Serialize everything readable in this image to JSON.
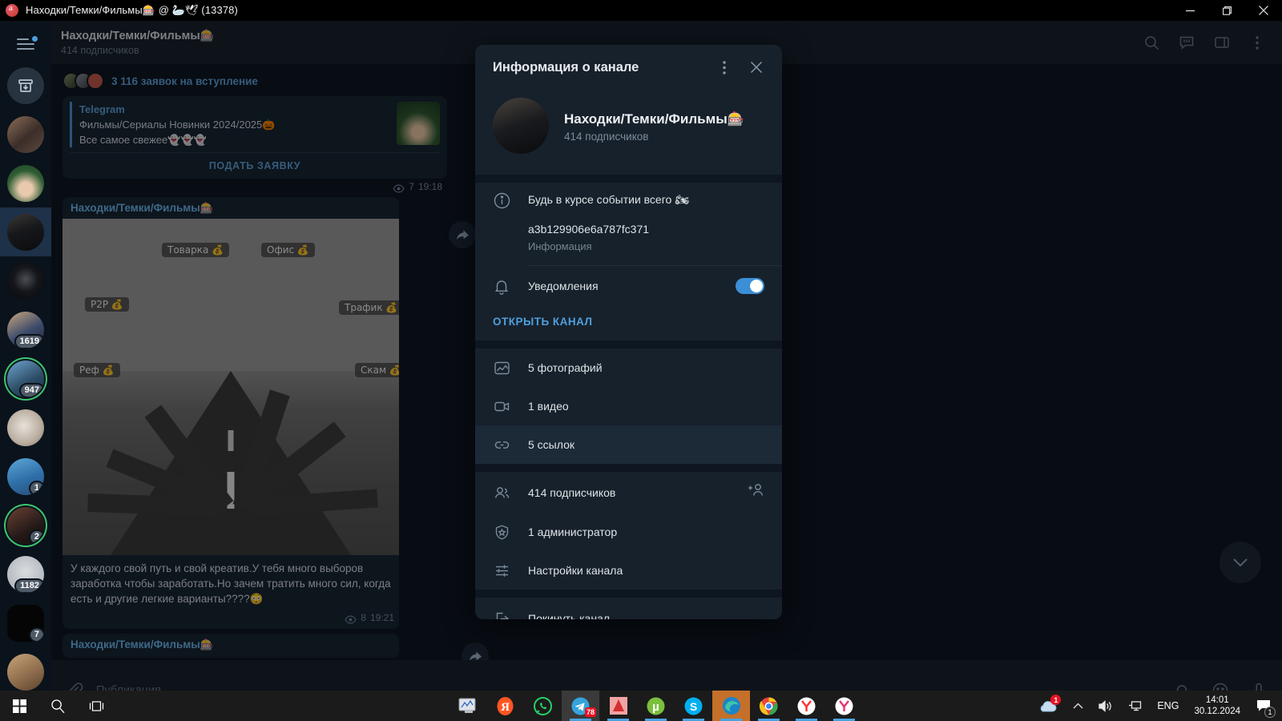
{
  "window": {
    "title": "Находки/Темки/Фильмы🎰 @ 🦢🕊 (13378)",
    "minimize": "−",
    "maximize": "▢",
    "close": "✕"
  },
  "chat_header": {
    "title": "Находки/Темки/Фильмы🎰",
    "subtitle": "414 подписчиков",
    "icons": [
      "search-icon",
      "comments-icon",
      "panel-icon",
      "menu-icon"
    ]
  },
  "sidebar": {
    "items": [
      {
        "name": "archive",
        "badge": ""
      },
      {
        "name": "chat-avatar-1",
        "badge": ""
      },
      {
        "name": "chat-avatar-2",
        "badge": ""
      },
      {
        "name": "chat-avatar-3-active",
        "badge": ""
      },
      {
        "name": "chat-avatar-4",
        "badge": ""
      },
      {
        "name": "chat-avatar-5",
        "badge": "1619"
      },
      {
        "name": "chat-avatar-6",
        "badge": "947"
      },
      {
        "name": "chat-avatar-7",
        "badge": ""
      },
      {
        "name": "chat-avatar-8",
        "badge": "1"
      },
      {
        "name": "chat-avatar-9",
        "badge": "2"
      },
      {
        "name": "chat-avatar-10",
        "badge": "1182"
      },
      {
        "name": "chat-avatar-11",
        "badge": "7"
      },
      {
        "name": "chat-avatar-12",
        "badge": ""
      }
    ]
  },
  "messages": {
    "join_requests": "3 116 заявок на вступление",
    "link_message": {
      "site": "Telegram",
      "line1": "Фильмы/Сериалы Новинки 2024/2025🎃",
      "line2": "Все самое свежее👻👻👻",
      "button": "ПОДАТЬ ЗАЯВКУ",
      "views": "7",
      "time": "19:18"
    },
    "photo_message": {
      "author": "Находки/Темки/Фильмы🎰",
      "labels": [
        "Товарка 💰",
        "Офис 💰",
        "P2P 💰",
        "Трафик 💰",
        "Реф 💰",
        "Скам 💰"
      ],
      "caption": "У каждого свой путь и свой креатив.У тебя много выборов заработка чтобы заработать.Но зачем тратить много сил, когда есть и другие легкие варианты????😳",
      "views": "8",
      "time": "19:21"
    },
    "next_author": "Находки/Темки/Фильмы🎰"
  },
  "composer": {
    "placeholder": "Публикация...",
    "attach_icon": "paperclip-icon",
    "bell_icon": "bell-icon",
    "emoji_icon": "emoji-icon",
    "mic_icon": "microphone-icon",
    "scroll_icon": "chevron-down-icon"
  },
  "dialog": {
    "title": "Информация о каналe",
    "title_exact": "Информация о канале",
    "menu_icon": "more-vertical-icon",
    "close_icon": "close-icon",
    "channel_name": "Находки/Темки/Фильмы🎰",
    "subscribers": "414 подписчиков",
    "about_text": "Будь в курсе событии всего 🏍",
    "username": "a3b129906e6a787fc371",
    "username_label": "Информация",
    "notifications_label": "Уведомления",
    "notifications_on": true,
    "open_channel": "ОТКРЫТЬ КАНАЛ",
    "media": [
      {
        "icon": "photo-icon",
        "label": "5 фотографий",
        "active": false
      },
      {
        "icon": "video-icon",
        "label": "1 видео",
        "active": false
      },
      {
        "icon": "link-icon",
        "label": "5 ссылок",
        "active": true
      }
    ],
    "management": [
      {
        "icon": "members-icon",
        "label": "414 подписчиков",
        "action": "add-member-icon"
      },
      {
        "icon": "shield-icon",
        "label": "1 администратор",
        "action": ""
      },
      {
        "icon": "sliders-icon",
        "label": "Настройки канала",
        "action": ""
      }
    ],
    "leave": {
      "icon": "leave-icon",
      "label": "Покинуть канал"
    }
  },
  "taskbar": {
    "start_icon": "windows-start-icon",
    "search_icon": "search-icon",
    "taskview_icon": "task-view-icon",
    "apps": [
      {
        "name": "monitor-app",
        "badge": ""
      },
      {
        "name": "yandex-browser-app",
        "badge": ""
      },
      {
        "name": "whatsapp-app",
        "badge": ""
      },
      {
        "name": "telegram-app",
        "badge": "78"
      },
      {
        "name": "autocad-app",
        "badge": ""
      },
      {
        "name": "utorrent-app",
        "badge": ""
      },
      {
        "name": "skype-app",
        "badge": ""
      },
      {
        "name": "edge-app",
        "badge": ""
      },
      {
        "name": "chrome-app",
        "badge": ""
      },
      {
        "name": "yandex-app-2",
        "badge": ""
      },
      {
        "name": "yandex-app-3",
        "badge": ""
      }
    ],
    "tray": {
      "cloud_badge": "1",
      "language": "ENG",
      "time": "14:01",
      "date": "30.12.2024",
      "notification_count": "1"
    }
  }
}
